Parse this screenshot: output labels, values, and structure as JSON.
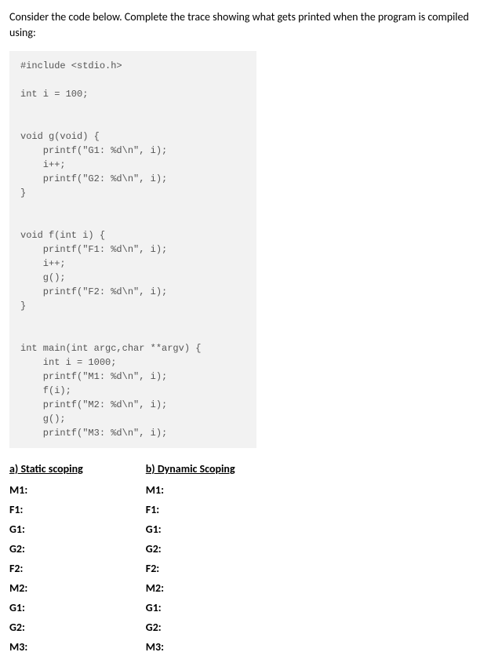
{
  "prompt": "Consider the code below. Complete the trace showing what gets printed when the program is compiled using:",
  "code": "#include <stdio.h>\n\nint i = 100;\n\n\nvoid g(void) {\n    printf(\"G1: %d\\n\", i);\n    i++;\n    printf(\"G2: %d\\n\", i);\n}\n\n\nvoid f(int i) {\n    printf(\"F1: %d\\n\", i);\n    i++;\n    g();\n    printf(\"F2: %d\\n\", i);\n}\n\n\nint main(int argc,char **argv) {\n    int i = 1000;\n    printf(\"M1: %d\\n\", i);\n    f(i);\n    printf(\"M2: %d\\n\", i);\n    g();\n    printf(\"M3: %d\\n\", i);",
  "sections": [
    {
      "header": "a) Static scoping",
      "labels": [
        "M1:",
        "F1:",
        "G1:",
        "G2:",
        "F2:",
        "M2:",
        "G1:",
        "G2:",
        "M3:"
      ]
    },
    {
      "header": "b) Dynamic Scoping",
      "labels": [
        "M1:",
        "F1:",
        "G1:",
        "G2:",
        "F2:",
        "M2:",
        "G1:",
        "G2:",
        "M3:"
      ]
    }
  ]
}
